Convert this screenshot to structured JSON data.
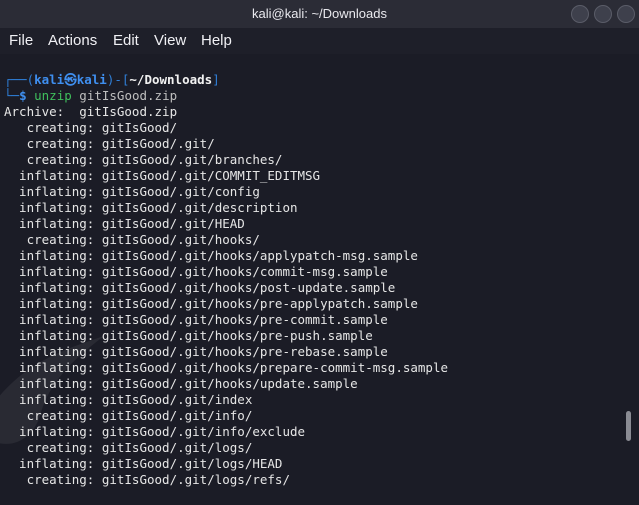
{
  "window": {
    "title": "kali@kali: ~/Downloads"
  },
  "menu": {
    "file": "File",
    "actions": "Actions",
    "edit": "Edit",
    "view": "View",
    "help": "Help"
  },
  "prompt": {
    "top_left": "┌──(",
    "user": "kali㉿kali",
    "mid": ")-[",
    "path": "~/Downloads",
    "end": "]",
    "bottom_left": "└─",
    "symbol": "$",
    "command": "unzip",
    "argument": "gitIsGood.zip"
  },
  "output": [
    "Archive:  gitIsGood.zip",
    "   creating: gitIsGood/",
    "   creating: gitIsGood/.git/",
    "   creating: gitIsGood/.git/branches/",
    "  inflating: gitIsGood/.git/COMMIT_EDITMSG",
    "  inflating: gitIsGood/.git/config",
    "  inflating: gitIsGood/.git/description",
    "  inflating: gitIsGood/.git/HEAD",
    "   creating: gitIsGood/.git/hooks/",
    "  inflating: gitIsGood/.git/hooks/applypatch-msg.sample",
    "  inflating: gitIsGood/.git/hooks/commit-msg.sample",
    "  inflating: gitIsGood/.git/hooks/post-update.sample",
    "  inflating: gitIsGood/.git/hooks/pre-applypatch.sample",
    "  inflating: gitIsGood/.git/hooks/pre-commit.sample",
    "  inflating: gitIsGood/.git/hooks/pre-push.sample",
    "  inflating: gitIsGood/.git/hooks/pre-rebase.sample",
    "  inflating: gitIsGood/.git/hooks/prepare-commit-msg.sample",
    "  inflating: gitIsGood/.git/hooks/update.sample",
    "  inflating: gitIsGood/.git/index",
    "   creating: gitIsGood/.git/info/",
    "  inflating: gitIsGood/.git/info/exclude",
    "   creating: gitIsGood/.git/logs/",
    "  inflating: gitIsGood/.git/logs/HEAD",
    "   creating: gitIsGood/.git/logs/refs/"
  ],
  "colors": {
    "background": "#1b1c26",
    "titlebar": "#2b2c36",
    "prompt_blue": "#2f7fd8",
    "command_green": "#3fbf5c",
    "text": "#e6e6e6"
  },
  "icons": {
    "minimize": "minimize-icon",
    "maximize": "maximize-icon",
    "close": "close-icon"
  }
}
